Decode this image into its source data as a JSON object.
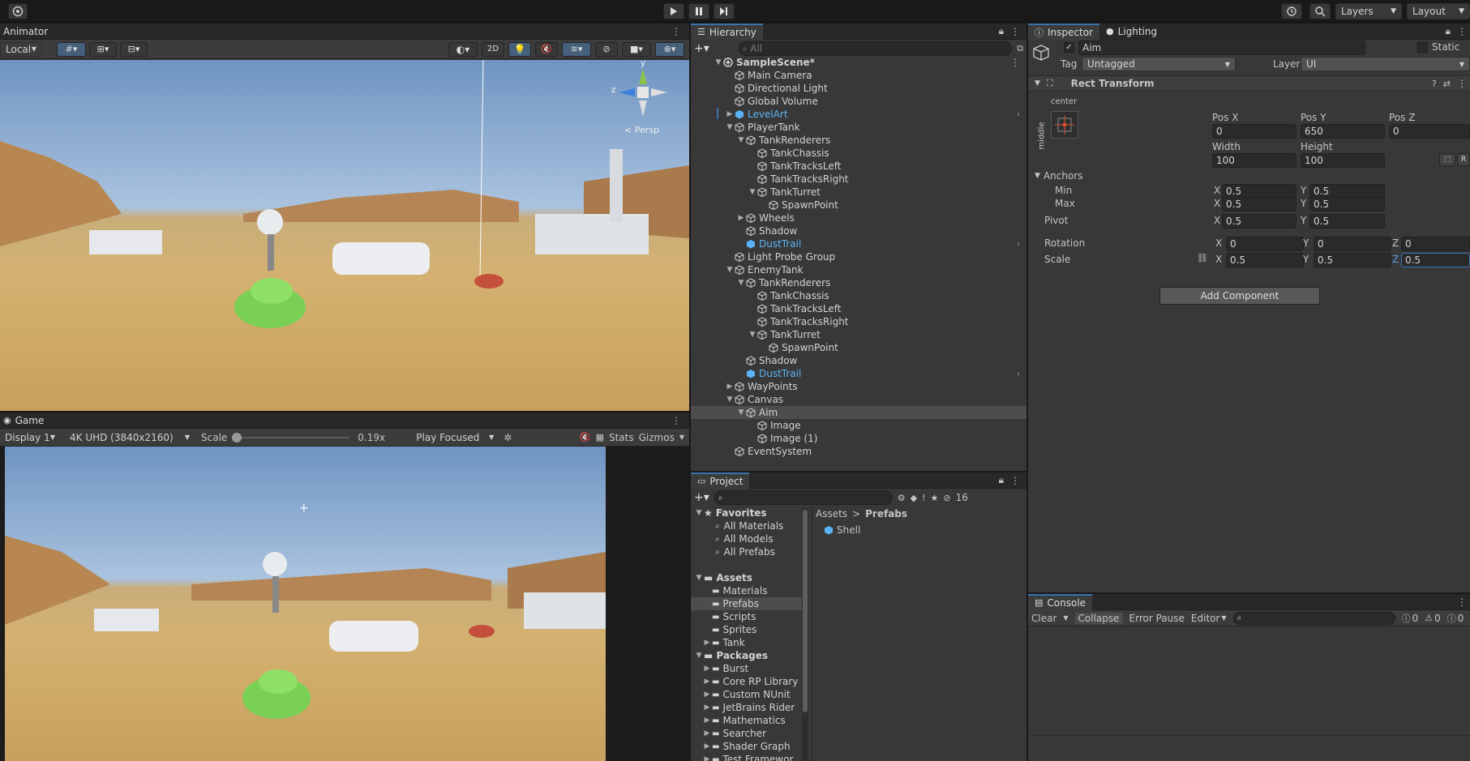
{
  "topbar": {
    "layers_label": "Layers",
    "layout_label": "Layout"
  },
  "scene_view": {
    "tab_label": "Animator",
    "pivot_mode": "Local",
    "mode_2d": "2D",
    "gizmo_axis_y": "y",
    "gizmo_axis_z": "z",
    "persp_label": "< Persp"
  },
  "game_view": {
    "tab_label": "Game",
    "display": "Display 1",
    "resolution": "4K UHD (3840x2160)",
    "scale_label": "Scale",
    "scale_value": "0.19x",
    "scale_fraction": 0.0,
    "play_mode": "Play Focused",
    "stats_label": "Stats",
    "gizmos_label": "Gizmos",
    "crosshair": "+"
  },
  "hierarchy": {
    "tab_label": "Hierarchy",
    "search_placeholder": "All",
    "items": [
      {
        "label": "SampleScene*",
        "depth": 0,
        "arrow": "down",
        "icon": "scene-icon",
        "style": "bold"
      },
      {
        "label": "Main Camera",
        "depth": 1,
        "arrow": "",
        "icon": "gameobject-icon",
        "style": ""
      },
      {
        "label": "Directional Light",
        "depth": 1,
        "arrow": "",
        "icon": "gameobject-icon",
        "style": ""
      },
      {
        "label": "Global Volume",
        "depth": 1,
        "arrow": "",
        "icon": "gameobject-icon",
        "style": ""
      },
      {
        "label": "LevelArt",
        "depth": 1,
        "arrow": "right",
        "icon": "prefab-icon",
        "style": "prefab",
        "chevron": true
      },
      {
        "label": "PlayerTank",
        "depth": 1,
        "arrow": "down",
        "icon": "gameobject-icon",
        "style": ""
      },
      {
        "label": "TankRenderers",
        "depth": 2,
        "arrow": "down",
        "icon": "gameobject-icon",
        "style": ""
      },
      {
        "label": "TankChassis",
        "depth": 3,
        "arrow": "",
        "icon": "gameobject-icon",
        "style": ""
      },
      {
        "label": "TankTracksLeft",
        "depth": 3,
        "arrow": "",
        "icon": "gameobject-icon",
        "style": ""
      },
      {
        "label": "TankTracksRight",
        "depth": 3,
        "arrow": "",
        "icon": "gameobject-icon",
        "style": ""
      },
      {
        "label": "TankTurret",
        "depth": 3,
        "arrow": "down",
        "icon": "gameobject-icon",
        "style": ""
      },
      {
        "label": "SpawnPoint",
        "depth": 4,
        "arrow": "",
        "icon": "gameobject-icon",
        "style": ""
      },
      {
        "label": "Wheels",
        "depth": 2,
        "arrow": "right",
        "icon": "gameobject-icon",
        "style": ""
      },
      {
        "label": "Shadow",
        "depth": 2,
        "arrow": "",
        "icon": "gameobject-icon",
        "style": ""
      },
      {
        "label": "DustTrail",
        "depth": 2,
        "arrow": "",
        "icon": "prefab-icon",
        "style": "prefab",
        "chevron": true
      },
      {
        "label": "Light Probe Group",
        "depth": 1,
        "arrow": "",
        "icon": "gameobject-icon",
        "style": ""
      },
      {
        "label": "EnemyTank",
        "depth": 1,
        "arrow": "down",
        "icon": "gameobject-icon",
        "style": ""
      },
      {
        "label": "TankRenderers",
        "depth": 2,
        "arrow": "down",
        "icon": "gameobject-icon",
        "style": ""
      },
      {
        "label": "TankChassis",
        "depth": 3,
        "arrow": "",
        "icon": "gameobject-icon",
        "style": ""
      },
      {
        "label": "TankTracksLeft",
        "depth": 3,
        "arrow": "",
        "icon": "gameobject-icon",
        "style": ""
      },
      {
        "label": "TankTracksRight",
        "depth": 3,
        "arrow": "",
        "icon": "gameobject-icon",
        "style": ""
      },
      {
        "label": "TankTurret",
        "depth": 3,
        "arrow": "down",
        "icon": "gameobject-icon",
        "style": ""
      },
      {
        "label": "SpawnPoint",
        "depth": 4,
        "arrow": "",
        "icon": "gameobject-icon",
        "style": ""
      },
      {
        "label": "Shadow",
        "depth": 2,
        "arrow": "",
        "icon": "gameobject-icon",
        "style": ""
      },
      {
        "label": "DustTrail",
        "depth": 2,
        "arrow": "",
        "icon": "prefab-icon",
        "style": "prefab",
        "chevron": true
      },
      {
        "label": "WayPoints",
        "depth": 1,
        "arrow": "right",
        "icon": "gameobject-icon",
        "style": ""
      },
      {
        "label": "Canvas",
        "depth": 1,
        "arrow": "down",
        "icon": "gameobject-icon",
        "style": ""
      },
      {
        "label": "Aim",
        "depth": 2,
        "arrow": "down",
        "icon": "gameobject-icon",
        "style": "selected"
      },
      {
        "label": "Image",
        "depth": 3,
        "arrow": "",
        "icon": "gameobject-icon",
        "style": ""
      },
      {
        "label": "Image (1)",
        "depth": 3,
        "arrow": "",
        "icon": "gameobject-icon",
        "style": ""
      },
      {
        "label": "EventSystem",
        "depth": 1,
        "arrow": "",
        "icon": "gameobject-icon",
        "style": ""
      }
    ]
  },
  "project": {
    "tab_label": "Project",
    "hidden_count": "16",
    "favorites_label": "Favorites",
    "favorites": [
      "All Materials",
      "All Models",
      "All Prefabs"
    ],
    "assets_label": "Assets",
    "assets": [
      {
        "label": "Materials",
        "arrow": ""
      },
      {
        "label": "Prefabs",
        "arrow": "",
        "selected": true
      },
      {
        "label": "Scripts",
        "arrow": ""
      },
      {
        "label": "Sprites",
        "arrow": ""
      },
      {
        "label": "Tank",
        "arrow": "right"
      }
    ],
    "packages_label": "Packages",
    "packages": [
      "Burst",
      "Core RP Library",
      "Custom NUnit",
      "JetBrains Rider",
      "Mathematics",
      "Searcher",
      "Shader Graph",
      "Test Framewor"
    ],
    "breadcrumb_root": "Assets",
    "breadcrumb_sep": ">",
    "breadcrumb_current": "Prefabs",
    "files": [
      "Shell"
    ]
  },
  "inspector": {
    "tab_label": "Inspector",
    "lighting_tab_label": "Lighting",
    "object_name": "Aim",
    "static_label": "Static",
    "tag_label": "Tag",
    "tag_value": "Untagged",
    "layer_label": "Layer",
    "layer_value": "UI",
    "component_title": "Rect Transform",
    "anchor_h": "center",
    "anchor_v": "middle",
    "pos_x_label": "Pos X",
    "pos_y_label": "Pos Y",
    "pos_z_label": "Pos Z",
    "pos_x": "0",
    "pos_y": "650",
    "pos_z": "0",
    "width_label": "Width",
    "height_label": "Height",
    "width": "100",
    "height": "100",
    "anchors_label": "Anchors",
    "min_label": "Min",
    "max_label": "Max",
    "pivot_label": "Pivot",
    "rotation_label": "Rotation",
    "scale_label": "Scale",
    "x": "X",
    "y": "Y",
    "z": "Z",
    "min_x": "0.5",
    "min_y": "0.5",
    "max_x": "0.5",
    "max_y": "0.5",
    "pivot_x": "0.5",
    "pivot_y": "0.5",
    "rot_x": "0",
    "rot_y": "0",
    "rot_z": "0",
    "scale_x": "0.5",
    "scale_y": "0.5",
    "scale_z": "0.5",
    "add_component": "Add Component"
  },
  "console": {
    "tab_label": "Console",
    "clear_label": "Clear",
    "collapse_label": "Collapse",
    "error_pause_label": "Error Pause",
    "editor_label": "Editor",
    "log_count": "0",
    "warn_count": "0",
    "error_count": "0"
  },
  "colors": {
    "selection": "#4d4d4d",
    "prefab_text": "#5bb3f5",
    "accent": "#3a72b0"
  }
}
